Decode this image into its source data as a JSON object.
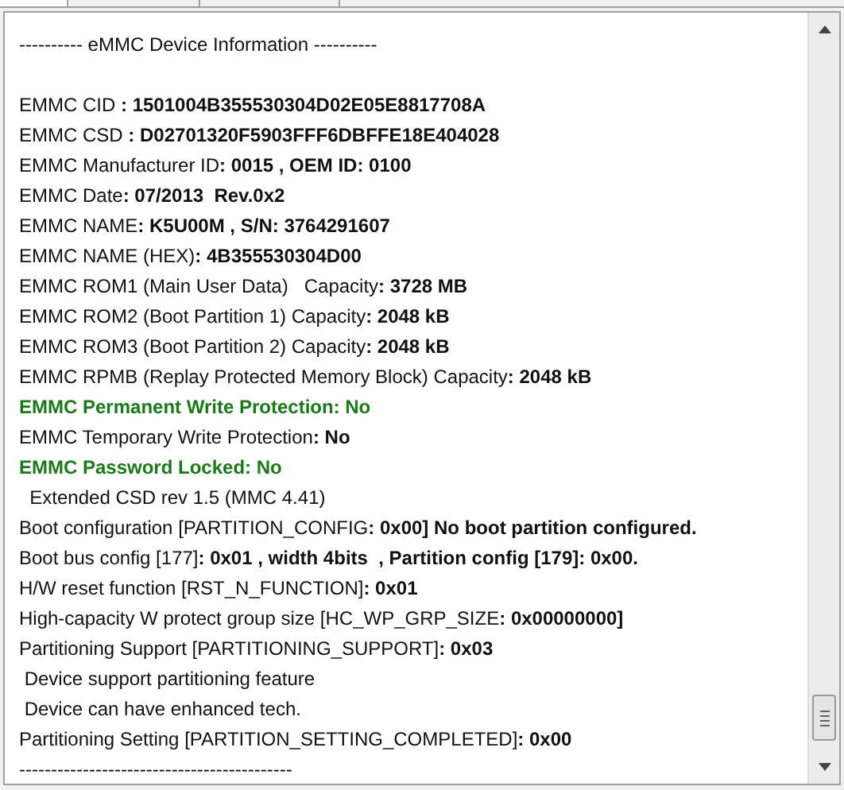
{
  "header": "---------- eMMC Device Information ----------",
  "lines": [
    {
      "kind": "normal",
      "text": "EMMC CID **: 1501004B355530304D02E05E8817708A**"
    },
    {
      "kind": "normal",
      "text": "EMMC CSD **: D02701320F5903FFF6DBFFE18E404028**"
    },
    {
      "kind": "normal",
      "text": "EMMC Manufacturer ID**: 0015 , OEM ID: 0100**"
    },
    {
      "kind": "normal",
      "text": "EMMC Date**: 07/2013  Rev.0x2**"
    },
    {
      "kind": "normal",
      "text": "EMMC NAME**: K5U00M , S/N: 3764291607**"
    },
    {
      "kind": "normal",
      "text": "EMMC NAME (HEX)**: 4B355530304D00**"
    },
    {
      "kind": "normal",
      "text": "EMMC ROM1 (Main User Data)   Capacity**: 3728 MB**"
    },
    {
      "kind": "normal",
      "text": "EMMC ROM2 (Boot Partition 1) Capacity**: 2048 kB**"
    },
    {
      "kind": "normal",
      "text": "EMMC ROM3 (Boot Partition 2) Capacity**: 2048 kB**"
    },
    {
      "kind": "normal",
      "text": "EMMC RPMB (Replay Protected Memory Block) Capacity**: 2048 kB**"
    },
    {
      "kind": "highlight",
      "text": "EMMC Permanent Write Protection: No"
    },
    {
      "kind": "normal",
      "text": "EMMC Temporary Write Protection**: No**"
    },
    {
      "kind": "highlight",
      "text": "EMMC Password Locked: No"
    },
    {
      "kind": "normal",
      "text": "  Extended CSD rev 1.5 (MMC 4.41)"
    },
    {
      "kind": "normal",
      "text": "Boot configuration [PARTITION_CONFIG**: 0x00] No boot partition configured.**"
    },
    {
      "kind": "normal",
      "text": "Boot bus config [177]**: 0x01 , width 4bits  , Partition config [179]: 0x00.**"
    },
    {
      "kind": "normal",
      "text": "H/W reset function [RST_N_FUNCTION]**: 0x01**"
    },
    {
      "kind": "normal",
      "text": "High-capacity W protect group size [HC_WP_GRP_SIZE**: 0x00000000]**"
    },
    {
      "kind": "normal",
      "text": "Partitioning Support [PARTITIONING_SUPPORT]**: 0x03**"
    },
    {
      "kind": "normal",
      "text": " Device support partitioning feature"
    },
    {
      "kind": "normal",
      "text": " Device can have enhanced tech."
    },
    {
      "kind": "normal",
      "text": "Partitioning Setting [PARTITION_SETTING_COMPLETED]**: 0x00**"
    }
  ],
  "footer": "-------------------------------------------"
}
